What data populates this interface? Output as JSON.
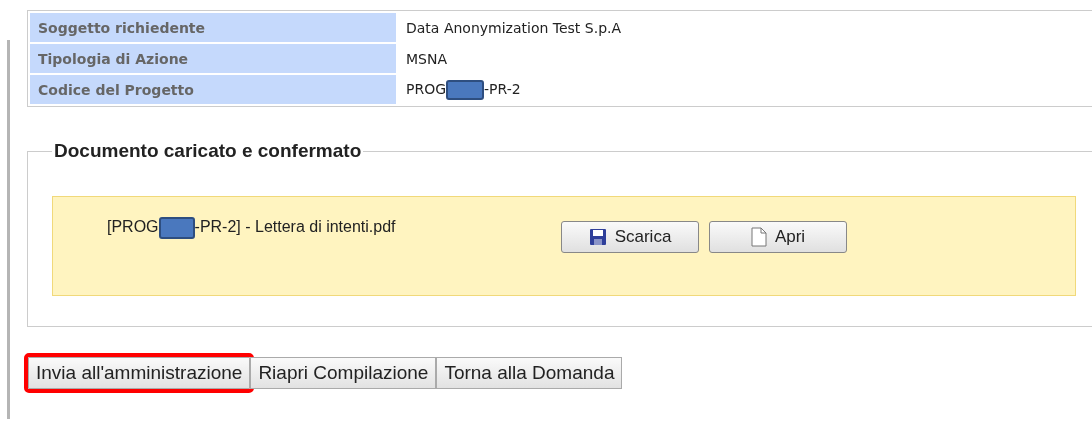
{
  "details": [
    {
      "label": "Soggetto richiedente",
      "value": "Data Anonymization Test S.p.A"
    },
    {
      "label": "Tipologia di Azione",
      "value": "MSNA"
    },
    {
      "label": "Codice del Progetto",
      "value": "PROG",
      "value_after": "-PR-2",
      "redacted": true
    }
  ],
  "document": {
    "legend": "Documento caricato e confermato",
    "file_before": "[PROG",
    "file_after": "-PR-2] - Lettera di intenti.pdf",
    "redacted": true,
    "buttons": [
      {
        "label": "Scarica",
        "kind": "save"
      },
      {
        "label": "Apri",
        "kind": "page"
      }
    ]
  },
  "actions": [
    {
      "label": "Invia all'amministrazione",
      "highlighted": true
    },
    {
      "label": "Riapri Compilazione",
      "highlighted": false
    },
    {
      "label": "Torna alla Domanda",
      "highlighted": false
    }
  ]
}
